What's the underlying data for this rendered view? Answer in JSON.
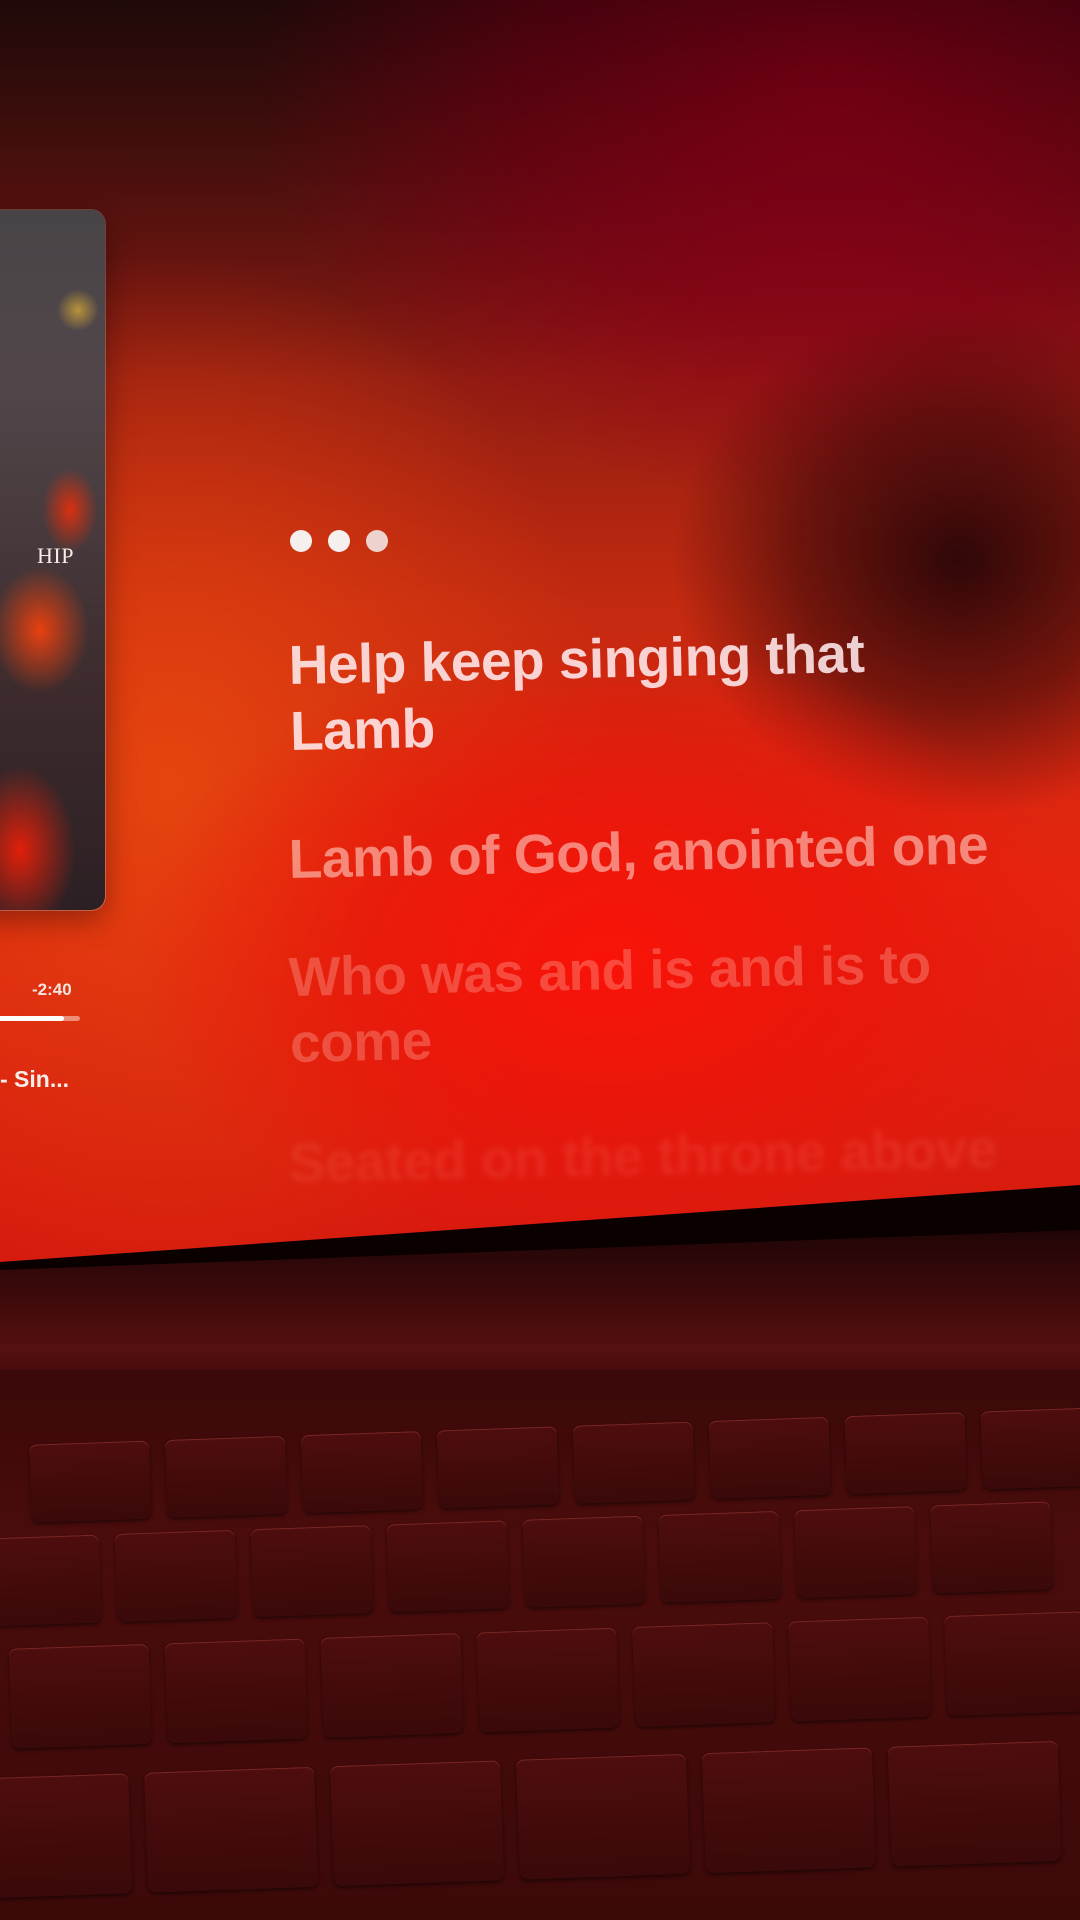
{
  "album": {
    "cover_text": "HIP"
  },
  "player": {
    "time_remaining": "-2:40",
    "progress": 0.82,
    "track_title": "- Sin..."
  },
  "lyrics": {
    "lines": [
      "Help keep singing that\nLamb",
      "Lamb of God, anointed one",
      "Who was and is and is to\ncome",
      "Seated on the throne above"
    ]
  },
  "colors": {
    "accent": "#e62410",
    "text_active": "#ffebee"
  },
  "icons": {
    "ellipsis": "ellipsis-dots-icon"
  }
}
